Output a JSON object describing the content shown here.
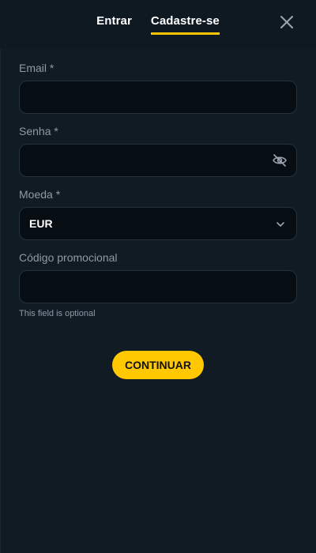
{
  "tabs": [
    {
      "label": "Entrar",
      "active": false
    },
    {
      "label": "Cadastre-se",
      "active": true
    }
  ],
  "icons": {
    "close": "close-icon",
    "eye": "eye-off-icon",
    "chevron": "chevron-down-icon"
  },
  "form": {
    "email": {
      "label": "Email *",
      "value": "",
      "placeholder": ""
    },
    "password": {
      "label": "Senha *",
      "value": "",
      "placeholder": ""
    },
    "currency": {
      "label": "Moeda *",
      "selected": "EUR"
    },
    "promo": {
      "label": "Código promocional",
      "value": "",
      "placeholder": "",
      "hint": "This field is optional"
    }
  },
  "continue_label": "CONTINUAR",
  "colors": {
    "background": "#0f1922",
    "accent": "#ffc800",
    "field_bg": "#060d13",
    "label": "#8e9aa6"
  }
}
